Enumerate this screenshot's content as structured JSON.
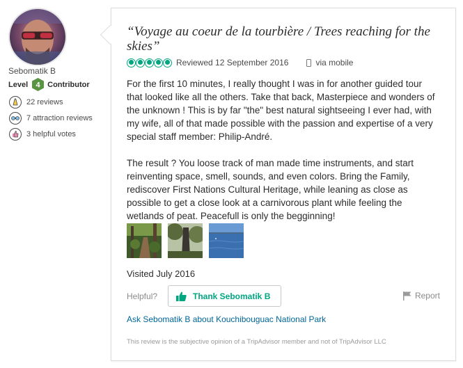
{
  "member": {
    "name": "Sebomatik B",
    "level_prefix": "Level",
    "level_number": "4",
    "level_title": "Contributor",
    "stats": [
      {
        "icon": "pencil-badge-icon",
        "text": "22 reviews"
      },
      {
        "icon": "attraction-badge-icon",
        "text": "7 attraction reviews"
      },
      {
        "icon": "thumbs-up-badge-icon",
        "text": "3 helpful votes"
      }
    ]
  },
  "review": {
    "title": "“Voyage au coeur de la tourbière / Trees reaching for the skies”",
    "rating_bubbles": 5,
    "rating_max": 5,
    "reviewed_date": "Reviewed 12 September 2016",
    "via": "via mobile",
    "body_paragraphs": [
      "For the first 10 minutes, I really thought I was in for another guided tour that looked like all the others. Take that back, Masterpiece and wonders of the unknown ! This is by far \"the\" best natural sightseeing I ever had, with my wife, all of that made possible with the passion and expertise of a very special staff member: Philip-André.",
      "The result ? You loose track of man made time instruments, and start reinventing space, smell, sounds, and even colors. Bring the Family, rediscover First Nations Cultural Heritage, while leaning as close as possible to get a close look at a carnivorous plant while feeling the wetlands of peat. Peacefull is only the begginning!"
    ],
    "photos": [
      "forest-path-photo",
      "tree-trunk-photo",
      "lake-water-photo"
    ],
    "visited": "Visited July 2016",
    "helpful_label": "Helpful?",
    "thank_button": "Thank Sebomatik B",
    "report_label": "Report",
    "ask_link": "Ask Sebomatik B about Kouchibouguac National Park",
    "disclaimer": "This review is the subjective opinion of a TripAdvisor member and not of TripAdvisor LLC"
  },
  "colors": {
    "accent_green": "#00a680",
    "link_blue": "#006699",
    "level_badge_green": "#589442"
  }
}
